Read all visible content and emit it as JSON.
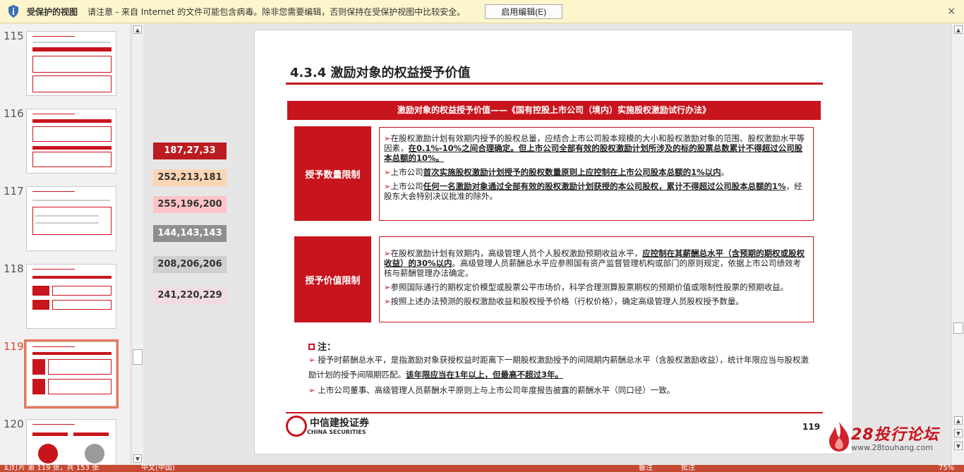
{
  "protected_bar": {
    "title": "受保护的视图",
    "message": "请注意 - 来自 Internet 的文件可能包含病毒。除非您需要编辑，否则保持在受保护视图中比较安全。",
    "enable_button": "启用编辑(E)",
    "close": "×"
  },
  "thumbnails": [
    {
      "num": "115"
    },
    {
      "num": "116"
    },
    {
      "num": "117"
    },
    {
      "num": "118"
    },
    {
      "num": "119",
      "active": true
    },
    {
      "num": "120"
    }
  ],
  "color_swatches": [
    {
      "label": "187,27,33",
      "bg": "#bb1b21",
      "fg": "#ffffff"
    },
    {
      "label": "252,213,181",
      "bg": "#fcd5b5",
      "fg": "#333333"
    },
    {
      "label": "255,196,200",
      "bg": "#ffc4c8",
      "fg": "#333333"
    },
    {
      "label": "144,143,143",
      "bg": "#908f8f",
      "fg": "#ffffff"
    },
    {
      "label": "208,206,206",
      "bg": "#d0cece",
      "fg": "#333333"
    },
    {
      "label": "241,220,229",
      "bg": "#f1dce5",
      "fg": "#333333"
    }
  ],
  "slide": {
    "heading": "4.3.4  激励对象的权益授予价值",
    "banner": "激励对象的权益授予价值——《国有控股上市公司（境内）实施股权激励试行办法》",
    "box1": {
      "label": "授予数量限制",
      "p1_a": "在股权激励计划有效期内授予的股权总量，应结合上市公司股本规模的大小和股权激励对象的范围、股权激励水平等因素，",
      "p1_b": "在0.1%-10%之间合理确定。但上市公司全部有效的股权激励计划所涉及的标的股票总数累计不得超过公司股本总额的10%。",
      "p2_a": "上市公司",
      "p2_b": "首次实施股权激励计划授予的股权数量原则上应控制在上市公司股本总额的1%以内",
      "p2_c": "。",
      "p3_a": "上市公司",
      "p3_b": "任何一名激励对象通过全部有效的股权激励计划获授的本公司股权，累计不得超过公司股本总额的1%",
      "p3_c": "，经股东大会特别决议批准的除外。"
    },
    "box2": {
      "label": "授予价值限制",
      "p1_a": "在股权激励计划有效期内，高级管理人员个人股权激励预期收益水平，",
      "p1_b": "应控制在其薪酬总水平（含预期的期权或股权收益）的30%以内",
      "p1_c": "。高级管理人员薪酬总水平应参照国有资产监督管理机构或部门的原则规定，依据上市公司绩效考核与薪酬管理办法确定。",
      "p2": "参照国际通行的期权定价模型或股票公平市场价，科学合理测算股票期权的预期价值或限制性股票的预期收益。",
      "p3": "按照上述办法预测的股权激励收益和股权授予价格（行权价格），确定高级管理人员股权授予数量。"
    },
    "note_title": "注：",
    "note1_a": "授予时薪酬总水平，是指激励对象获授权益时距离下一期股权激励授予的间隔期内薪酬总水平（含股权激励收益），统计年限应当与股权激励计划的授予间隔期匹配。",
    "note1_b": "该年限应当在1年以上，但最高不超过3年。",
    "note2": "上市公司董事、高级管理人员薪酬水平原则上与上市公司年度报告披露的薪酬水平（同口径）一致。",
    "logo_cn": "中信建投证券",
    "logo_en": "CHINA SECURITIES",
    "page_number": "119"
  },
  "watermark": {
    "brand": "28投行论坛",
    "url": "www.28touhang.com"
  },
  "status_bar": {
    "slide_info": "幻灯片 第 119 张，共 153 张",
    "language": "中文(中国)",
    "notes": "备注",
    "comments": "批注",
    "zoom": "75%"
  },
  "colors": {
    "accent": "#c8141c",
    "protected_bar": "#fdf5cc",
    "status_bar": "#c54a32"
  }
}
